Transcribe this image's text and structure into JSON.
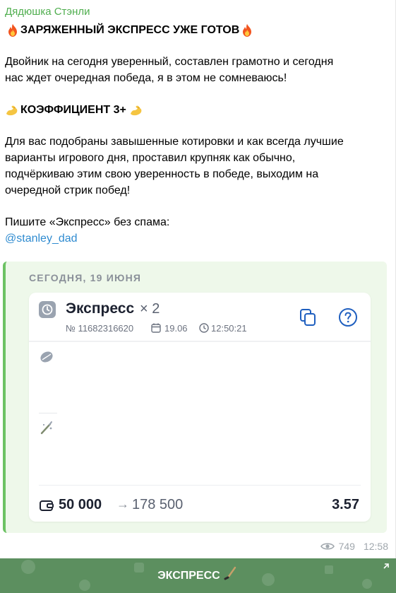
{
  "message": {
    "sender": "Дядюшка Стэнли",
    "headline": "ЗАРЯЖЕННЫЙ ЭКСПРЕСС УЖЕ ГОТОВ",
    "paragraph1": [
      "Двойник на сегодня уверенный, составлен грамотно и сегодня",
      "нас ждет очередная победа, я в этом не сомневаюсь!"
    ],
    "coef_line": "КОЭФФИЦИЕНТ 3+",
    "paragraph2": [
      "Для вас подобраны завышенные котировки и как всегда лучшие",
      "варианты игрового дня, проставил крупняк как обычно,",
      "подчёркиваю этим свою уверенность в победе, выходим на",
      "очередной стрик побед!"
    ],
    "cta": "Пишите «Экспресс» без спама:",
    "mention": "@stanley_dad",
    "views": "749",
    "time": "12:58"
  },
  "preview": {
    "date_label": "СЕГОДНЯ, 19 ИЮНЯ",
    "ticket": {
      "title": "Экспресс",
      "multiplier": "× 2",
      "number": "№ 11682316620",
      "date": "19.06",
      "time": "12:50:21",
      "stake": "50 000",
      "arrow": "→",
      "payout": "178 500",
      "coefficient": "3.57"
    }
  },
  "bottom_button": {
    "label": "ЭКСПРЕСС"
  },
  "colors": {
    "sender": "#4fae4e",
    "mention": "#2f8bd0",
    "preview_bar": "#6dc264",
    "preview_bg": "#eef8ea",
    "button_bg": "#5c8f5f",
    "icon_blue": "#1f5fbf"
  },
  "icons": [
    "fire-icon",
    "flexed-biceps-icon",
    "clock-icon",
    "calendar-icon",
    "copy-icon",
    "help-icon",
    "tennis-ball-icon",
    "hockey-icon",
    "wallet-icon",
    "eye-icon",
    "hockey-stick-icon",
    "external-arrow-icon"
  ]
}
